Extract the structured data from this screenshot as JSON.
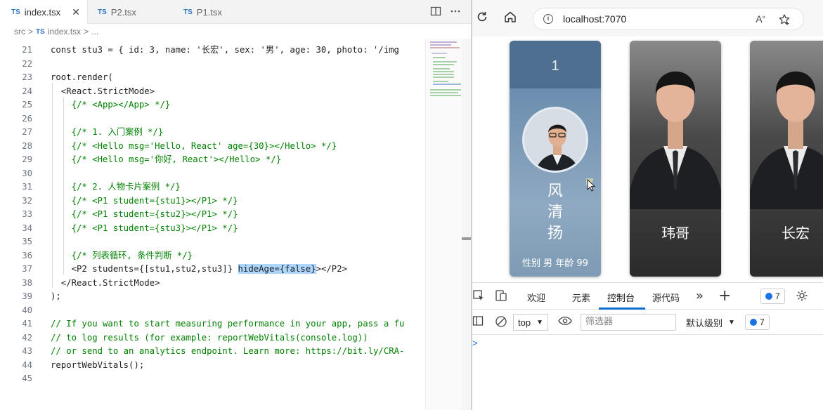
{
  "editor": {
    "tabs": [
      {
        "lang": "TS",
        "label": "index.tsx",
        "close": "✕"
      },
      {
        "lang": "TS",
        "label": "P2.tsx"
      },
      {
        "lang": "TS",
        "label": "P1.tsx"
      }
    ],
    "breadcrumb": [
      "src",
      ">",
      "TS",
      "index.tsx",
      ">",
      "..."
    ],
    "lines": [
      {
        "num": "21",
        "text": "const stu3 = { id: 3, name: '长宏', sex: '男', age: 30, photo: '/img"
      },
      {
        "num": "22",
        "text": ""
      },
      {
        "num": "23",
        "text": "root.render("
      },
      {
        "num": "24",
        "text": "  <React.StrictMode>"
      },
      {
        "num": "25",
        "text": "    {/* <App></App> */}"
      },
      {
        "num": "26",
        "text": ""
      },
      {
        "num": "27",
        "text": "    {/* 1. 入门案例 */}"
      },
      {
        "num": "28",
        "text": "    {/* <Hello msg='Hello, React' age={30}></Hello> */}"
      },
      {
        "num": "29",
        "text": "    {/* <Hello msg='你好, React'></Hello> */}"
      },
      {
        "num": "30",
        "text": ""
      },
      {
        "num": "31",
        "text": "    {/* 2. 人物卡片案例 */}"
      },
      {
        "num": "32",
        "text": "    {/* <P1 student={stu1}></P1> */}"
      },
      {
        "num": "33",
        "text": "    {/* <P1 student={stu2}></P1> */}"
      },
      {
        "num": "34",
        "text": "    {/* <P1 student={stu3}></P1> */}"
      },
      {
        "num": "35",
        "text": ""
      },
      {
        "num": "36",
        "text": "    {/* 列表循环, 条件判断 */}"
      },
      {
        "num": "37",
        "text": "    <P2 students={[stu1,stu2,stu3]} hideAge={false}></P2>"
      },
      {
        "num": "38",
        "text": "  </React.StrictMode>"
      },
      {
        "num": "39",
        "text": ");"
      },
      {
        "num": "40",
        "text": ""
      },
      {
        "num": "41",
        "text": "// If you want to start measuring performance in your app, pass a fu"
      },
      {
        "num": "42",
        "text": "// to log results (for example: reportWebVitals(console.log))"
      },
      {
        "num": "43",
        "text": "// or send to an analytics endpoint. Learn more: https://bit.ly/CRA-"
      },
      {
        "num": "44",
        "text": "reportWebVitals();"
      },
      {
        "num": "45",
        "text": ""
      }
    ],
    "line37": {
      "pre": "    <P2 students={[stu1,stu2,stu3]} ",
      "sel": "hideAge={false}",
      "post": "></P2>"
    }
  },
  "browser": {
    "url": "localhost:7070",
    "cards": [
      {
        "number": "1",
        "name_chars": [
          "风",
          "清",
          "扬"
        ],
        "info": "性别 男 年龄 99"
      },
      {
        "name": "玮哥"
      },
      {
        "name": "长宏"
      }
    ]
  },
  "devtools": {
    "tabs": [
      "欢迎",
      "元素",
      "控制台",
      "源代码"
    ],
    "more": "»",
    "add": "+",
    "issue_count": "7",
    "context": "top",
    "filter_placeholder": "筛选器",
    "level": "默认级别",
    "filter_issue_count": "7",
    "prompt": ">"
  }
}
